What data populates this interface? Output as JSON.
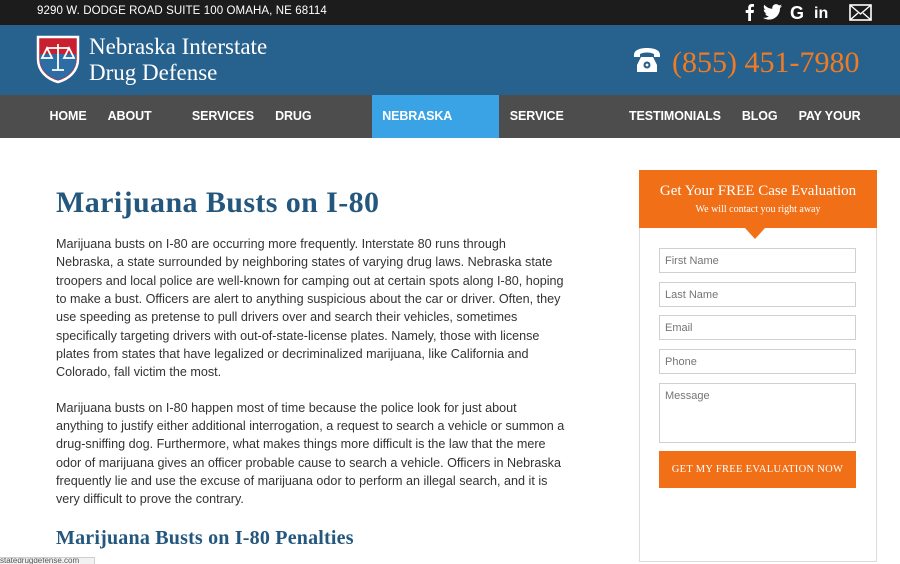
{
  "topbar": {
    "address": "9290 W. DODGE ROAD SUITE 100 OMAHA, NE 68114",
    "social": [
      {
        "icon": "facebook-icon",
        "glyph": "f"
      },
      {
        "icon": "twitter-icon",
        "glyph": "t"
      },
      {
        "icon": "google-icon",
        "glyph": "G"
      },
      {
        "icon": "linkedin-icon",
        "glyph": "in"
      },
      {
        "icon": "mail-icon",
        "glyph": ""
      }
    ]
  },
  "header": {
    "logo_line1": "Nebraska Interstate",
    "logo_line2": "Drug Defense",
    "phone": "(855) 451-7980"
  },
  "nav": {
    "items": [
      "HOME",
      "ABOUT US",
      "SERVICES",
      "DRUG CRIMES",
      "NEBRASKA LAWS",
      "SERVICE AREAS",
      "TESTIMONIALS",
      "BLOG",
      "PAY YOUR BILL"
    ],
    "active": "NEBRASKA LAWS"
  },
  "main": {
    "title": "Marijuana Busts on I-80",
    "paragraphs": [
      "Marijuana busts on I-80 are occurring more frequently. Interstate 80 runs through Nebraska, a state surrounded by neighboring states of varying drug laws. Nebraska state troopers and local police are well-known for camping out at certain spots along I-80, hoping to make a bust. Officers are alert to anything suspicious about the car or driver. Often, they use speeding as pretense to pull drivers over and search their vehicles, sometimes specifically targeting drivers with out-of-state-license plates. Namely, those with license plates from states that have legalized or decriminalized marijuana, like California and Colorado, fall victim the most.",
      "Marijuana busts on I-80 happen most of time because the police look for just about anything to justify either additional interrogation, a request to search a vehicle or summon a drug-sniffing dog. Furthermore, what makes things more difficult is the law that the mere odor of marijuana gives an officer probable cause to search a vehicle. Officers in Nebraska frequently lie and use the excuse of marijuana odor to perform an illegal search, and it is very difficult to prove the contrary."
    ],
    "subtitle": "Marijuana Busts on I-80 Penalties"
  },
  "form": {
    "heading": "Get Your FREE Case Evaluation",
    "subheading": "We will contact you right away",
    "placeholders": {
      "first_name": "First Name",
      "last_name": "Last Name",
      "email": "Email",
      "phone": "Phone",
      "message": "Message"
    },
    "submit_label": "GET MY FREE EVALUATION NOW"
  },
  "statusbar": {
    "url": "statedrugdefense.com"
  },
  "colors": {
    "header_blue": "#27618d",
    "accent_orange": "#f06f17",
    "nav_active": "#3aa3e6",
    "title_blue": "#24577d"
  }
}
